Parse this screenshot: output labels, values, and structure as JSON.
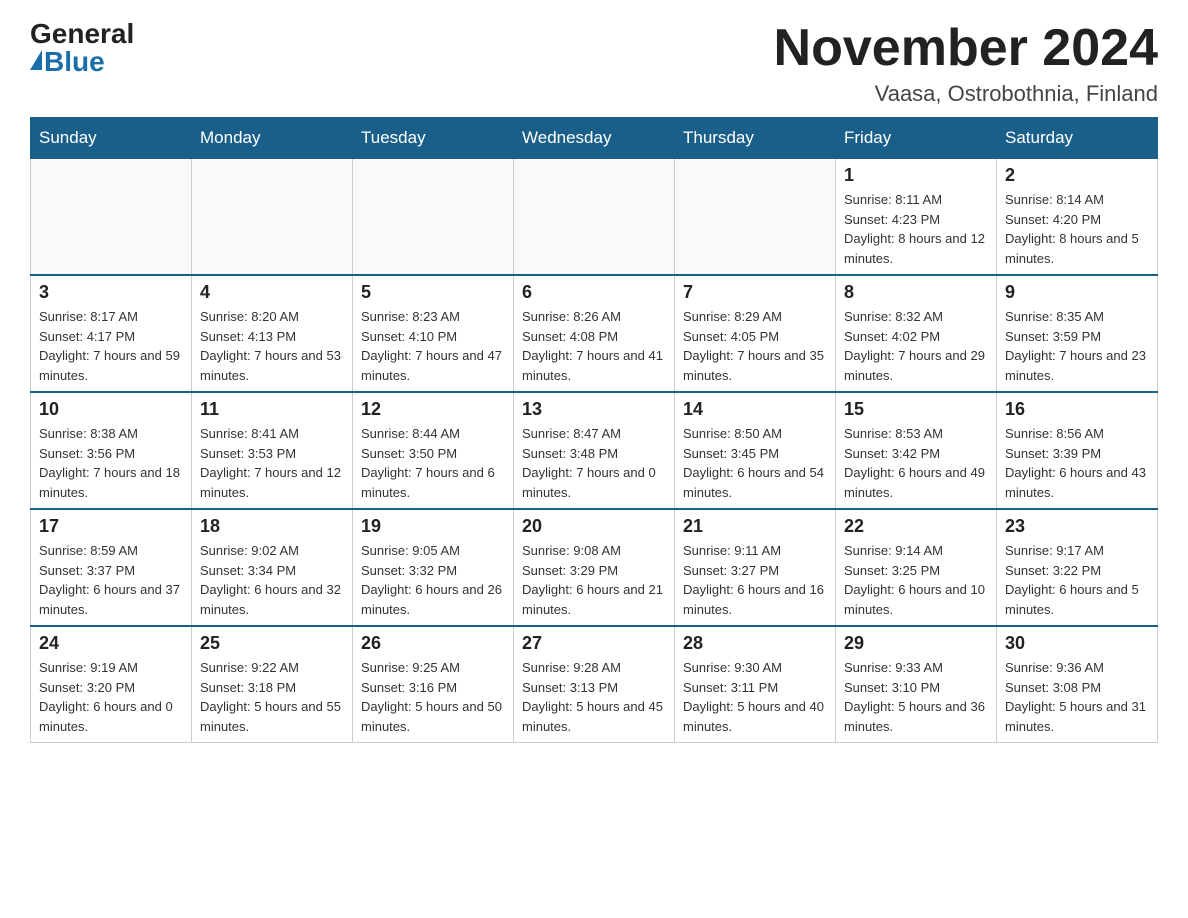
{
  "header": {
    "logo_general": "General",
    "logo_blue": "Blue",
    "month_title": "November 2024",
    "location": "Vaasa, Ostrobothnia, Finland"
  },
  "days_of_week": [
    "Sunday",
    "Monday",
    "Tuesday",
    "Wednesday",
    "Thursday",
    "Friday",
    "Saturday"
  ],
  "weeks": [
    [
      {
        "day": "",
        "info": ""
      },
      {
        "day": "",
        "info": ""
      },
      {
        "day": "",
        "info": ""
      },
      {
        "day": "",
        "info": ""
      },
      {
        "day": "",
        "info": ""
      },
      {
        "day": "1",
        "info": "Sunrise: 8:11 AM\nSunset: 4:23 PM\nDaylight: 8 hours and 12 minutes."
      },
      {
        "day": "2",
        "info": "Sunrise: 8:14 AM\nSunset: 4:20 PM\nDaylight: 8 hours and 5 minutes."
      }
    ],
    [
      {
        "day": "3",
        "info": "Sunrise: 8:17 AM\nSunset: 4:17 PM\nDaylight: 7 hours and 59 minutes."
      },
      {
        "day": "4",
        "info": "Sunrise: 8:20 AM\nSunset: 4:13 PM\nDaylight: 7 hours and 53 minutes."
      },
      {
        "day": "5",
        "info": "Sunrise: 8:23 AM\nSunset: 4:10 PM\nDaylight: 7 hours and 47 minutes."
      },
      {
        "day": "6",
        "info": "Sunrise: 8:26 AM\nSunset: 4:08 PM\nDaylight: 7 hours and 41 minutes."
      },
      {
        "day": "7",
        "info": "Sunrise: 8:29 AM\nSunset: 4:05 PM\nDaylight: 7 hours and 35 minutes."
      },
      {
        "day": "8",
        "info": "Sunrise: 8:32 AM\nSunset: 4:02 PM\nDaylight: 7 hours and 29 minutes."
      },
      {
        "day": "9",
        "info": "Sunrise: 8:35 AM\nSunset: 3:59 PM\nDaylight: 7 hours and 23 minutes."
      }
    ],
    [
      {
        "day": "10",
        "info": "Sunrise: 8:38 AM\nSunset: 3:56 PM\nDaylight: 7 hours and 18 minutes."
      },
      {
        "day": "11",
        "info": "Sunrise: 8:41 AM\nSunset: 3:53 PM\nDaylight: 7 hours and 12 minutes."
      },
      {
        "day": "12",
        "info": "Sunrise: 8:44 AM\nSunset: 3:50 PM\nDaylight: 7 hours and 6 minutes."
      },
      {
        "day": "13",
        "info": "Sunrise: 8:47 AM\nSunset: 3:48 PM\nDaylight: 7 hours and 0 minutes."
      },
      {
        "day": "14",
        "info": "Sunrise: 8:50 AM\nSunset: 3:45 PM\nDaylight: 6 hours and 54 minutes."
      },
      {
        "day": "15",
        "info": "Sunrise: 8:53 AM\nSunset: 3:42 PM\nDaylight: 6 hours and 49 minutes."
      },
      {
        "day": "16",
        "info": "Sunrise: 8:56 AM\nSunset: 3:39 PM\nDaylight: 6 hours and 43 minutes."
      }
    ],
    [
      {
        "day": "17",
        "info": "Sunrise: 8:59 AM\nSunset: 3:37 PM\nDaylight: 6 hours and 37 minutes."
      },
      {
        "day": "18",
        "info": "Sunrise: 9:02 AM\nSunset: 3:34 PM\nDaylight: 6 hours and 32 minutes."
      },
      {
        "day": "19",
        "info": "Sunrise: 9:05 AM\nSunset: 3:32 PM\nDaylight: 6 hours and 26 minutes."
      },
      {
        "day": "20",
        "info": "Sunrise: 9:08 AM\nSunset: 3:29 PM\nDaylight: 6 hours and 21 minutes."
      },
      {
        "day": "21",
        "info": "Sunrise: 9:11 AM\nSunset: 3:27 PM\nDaylight: 6 hours and 16 minutes."
      },
      {
        "day": "22",
        "info": "Sunrise: 9:14 AM\nSunset: 3:25 PM\nDaylight: 6 hours and 10 minutes."
      },
      {
        "day": "23",
        "info": "Sunrise: 9:17 AM\nSunset: 3:22 PM\nDaylight: 6 hours and 5 minutes."
      }
    ],
    [
      {
        "day": "24",
        "info": "Sunrise: 9:19 AM\nSunset: 3:20 PM\nDaylight: 6 hours and 0 minutes."
      },
      {
        "day": "25",
        "info": "Sunrise: 9:22 AM\nSunset: 3:18 PM\nDaylight: 5 hours and 55 minutes."
      },
      {
        "day": "26",
        "info": "Sunrise: 9:25 AM\nSunset: 3:16 PM\nDaylight: 5 hours and 50 minutes."
      },
      {
        "day": "27",
        "info": "Sunrise: 9:28 AM\nSunset: 3:13 PM\nDaylight: 5 hours and 45 minutes."
      },
      {
        "day": "28",
        "info": "Sunrise: 9:30 AM\nSunset: 3:11 PM\nDaylight: 5 hours and 40 minutes."
      },
      {
        "day": "29",
        "info": "Sunrise: 9:33 AM\nSunset: 3:10 PM\nDaylight: 5 hours and 36 minutes."
      },
      {
        "day": "30",
        "info": "Sunrise: 9:36 AM\nSunset: 3:08 PM\nDaylight: 5 hours and 31 minutes."
      }
    ]
  ]
}
